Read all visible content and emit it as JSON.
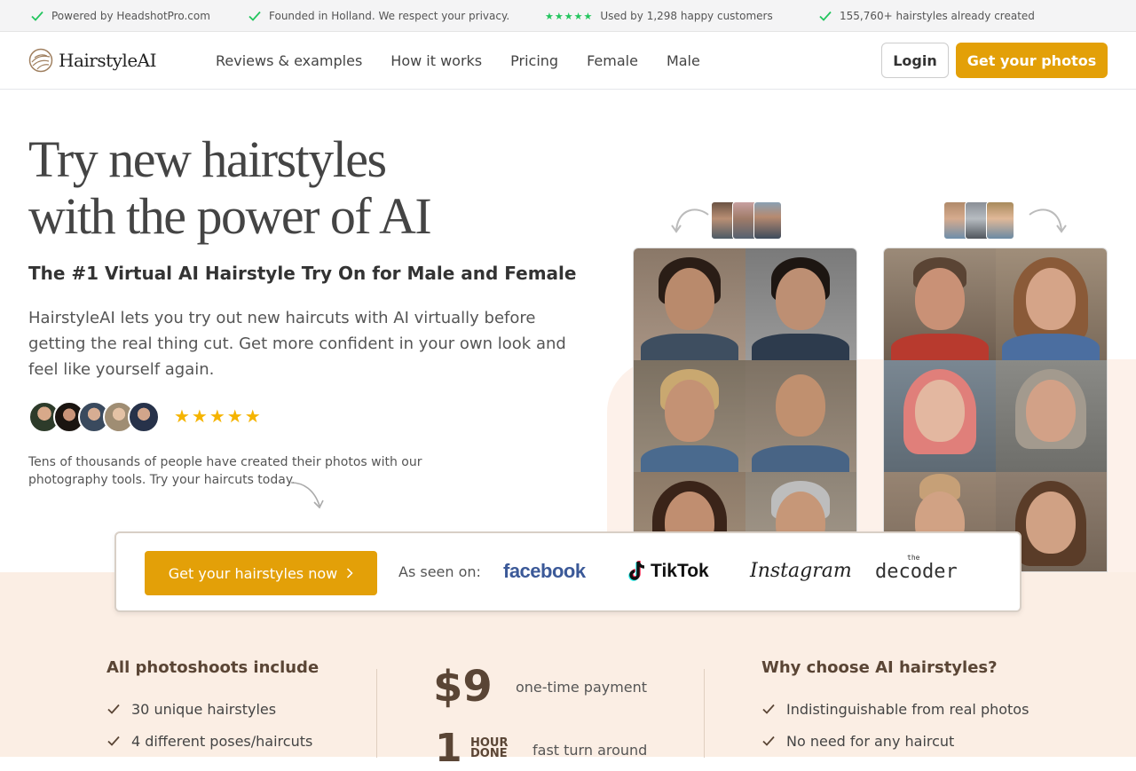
{
  "topbar": {
    "items": [
      "Powered by HeadshotPro.com",
      "Founded in Holland. We respect your privacy.",
      "Used by 1,298 happy customers",
      "155,760+ hairstyles already created"
    ],
    "stars": "★★★★★"
  },
  "nav": {
    "logo": "HairstyleAI",
    "links": [
      "Reviews & examples",
      "How it works",
      "Pricing",
      "Female",
      "Male"
    ],
    "login": "Login",
    "cta": "Get your photos"
  },
  "hero": {
    "title_line1": "Try new hairstyles",
    "title_line2": "with the power of AI",
    "subtitle": "The #1 Virtual AI Hairstyle Try On for Male and Female",
    "description": "HairstyleAI lets you try out new haircuts with AI virtually before getting the real thing cut. Get more confident in your own look and feel like yourself again.",
    "rating_stars": "★★★★★",
    "social_proof": "Tens of thousands of people have created their photos with our photography tools. Try your haircuts today."
  },
  "seen_on": {
    "button": "Get your hairstyles now",
    "label": "As seen on:",
    "logos": [
      "facebook",
      "TikTok",
      "Instagram",
      "decoder"
    ],
    "decoder_prefix": "the"
  },
  "features": {
    "left_title": "All photoshoots include",
    "left_items": [
      "30 unique hairstyles",
      "4 different poses/haircuts"
    ],
    "price": "$9",
    "price_note": "one-time payment",
    "turnaround_number": "1",
    "turnaround_unit_1": "HOUR",
    "turnaround_unit_2": "DONE",
    "turnaround_note": "fast turn around",
    "right_title": "Why choose AI hairstyles?",
    "right_items": [
      "Indistinguishable from real photos",
      "No need for any haircut"
    ]
  },
  "colors": {
    "accent": "#e3a008",
    "check_green": "#22c55e",
    "peach": "#fbeee4",
    "brown": "#5a4535"
  },
  "icons": {
    "check": "check-icon",
    "chevron": "chevron-right-icon",
    "logo": "hairstyle-logo-icon"
  }
}
